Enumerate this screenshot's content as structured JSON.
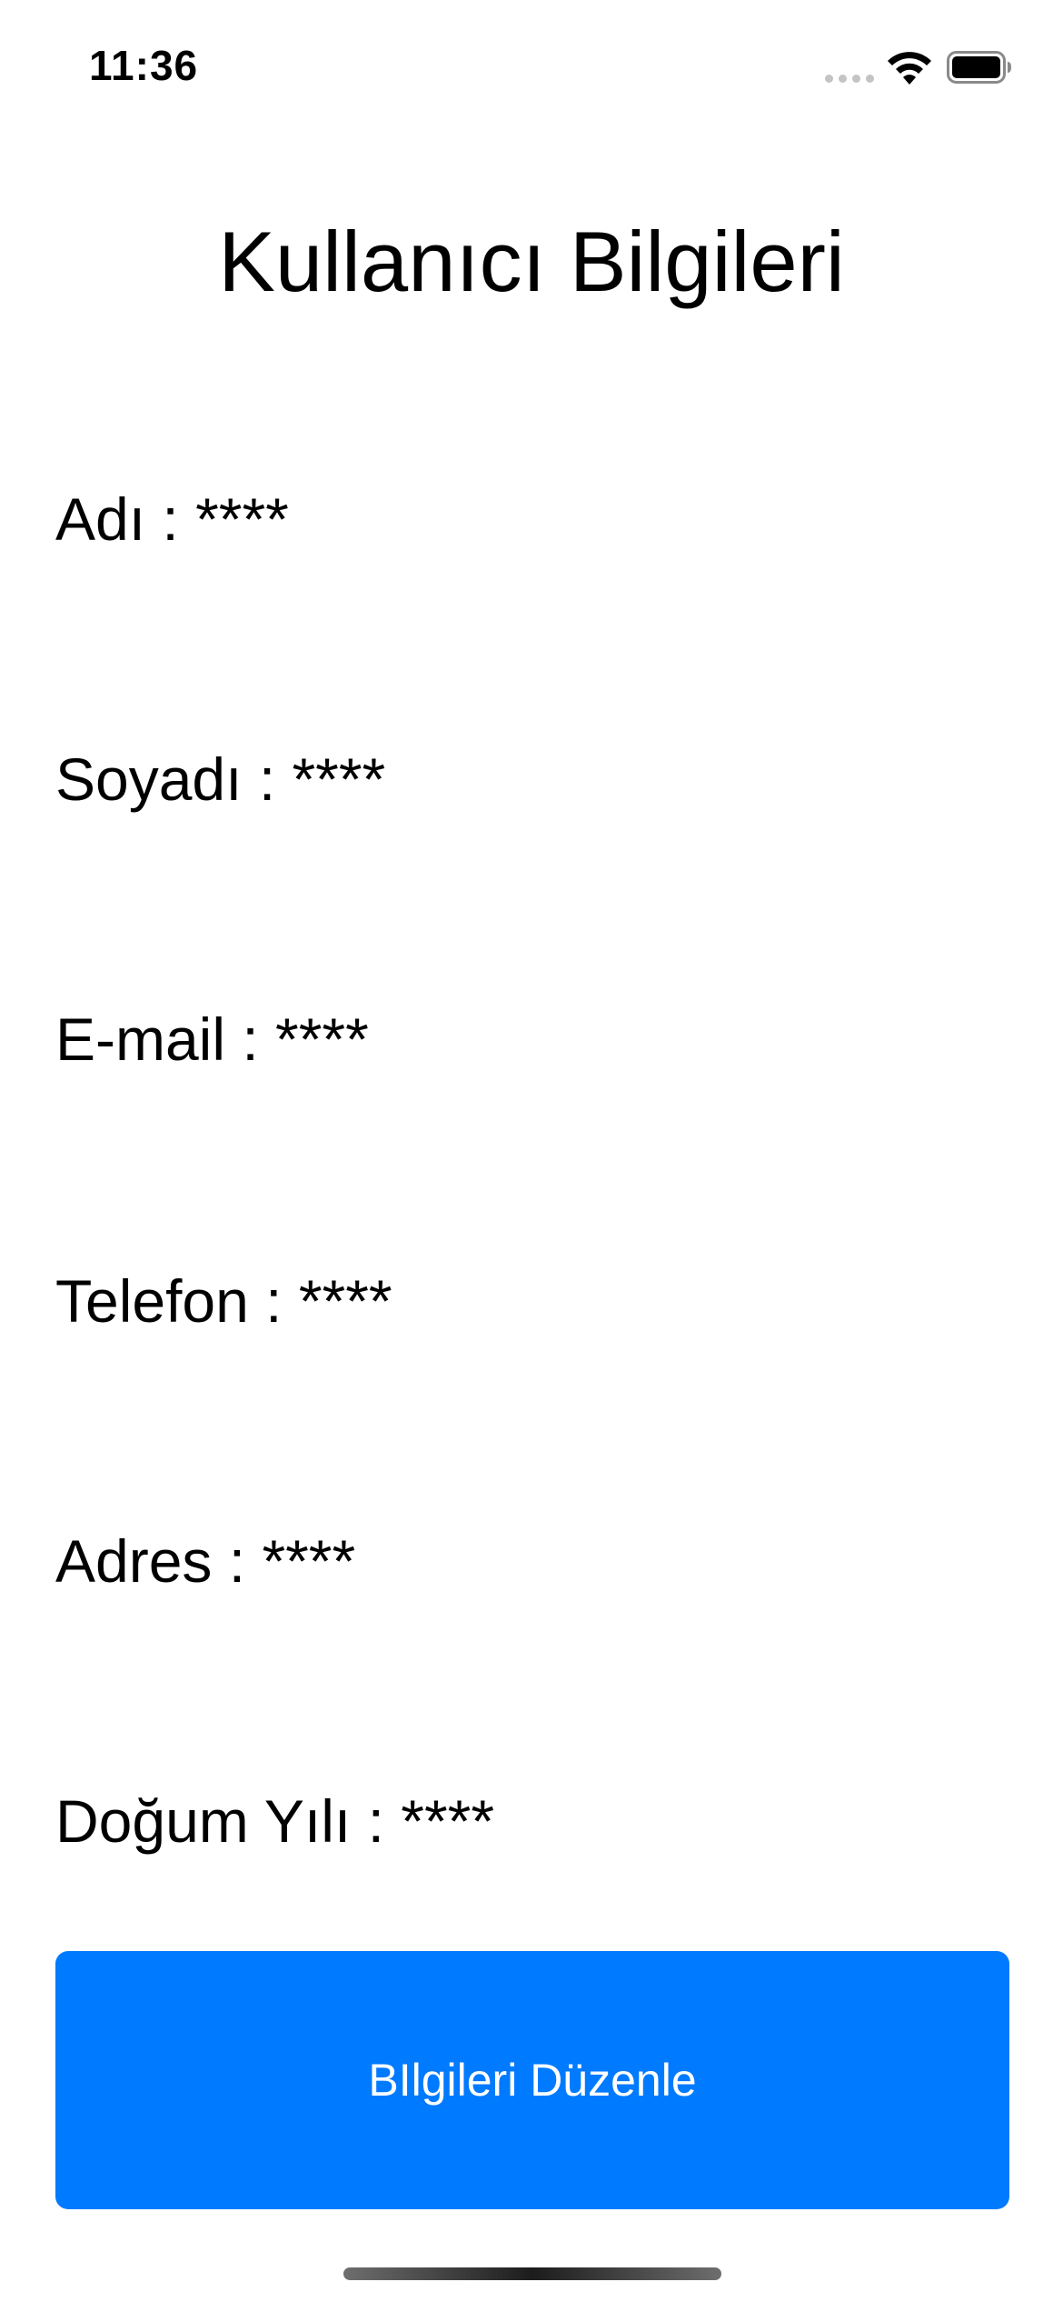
{
  "status_bar": {
    "time": "11:36",
    "signal_icon": "cellular-signal-icon",
    "wifi_icon": "wifi-icon",
    "battery_icon": "battery-full-icon"
  },
  "page": {
    "title": "Kullanıcı Bilgileri"
  },
  "fields": [
    {
      "label": "Adı",
      "value": "****"
    },
    {
      "label": "Soyadı",
      "value": "****"
    },
    {
      "label": "E-mail",
      "value": "****"
    },
    {
      "label": "Telefon",
      "value": "****"
    },
    {
      "label": "Adres",
      "value": "****"
    },
    {
      "label": "Doğum Yılı",
      "value": "****"
    }
  ],
  "edit_button": {
    "label": "BIlgileri Düzenle"
  },
  "colors": {
    "accent": "#007aff",
    "text": "#000000",
    "background": "#ffffff"
  }
}
